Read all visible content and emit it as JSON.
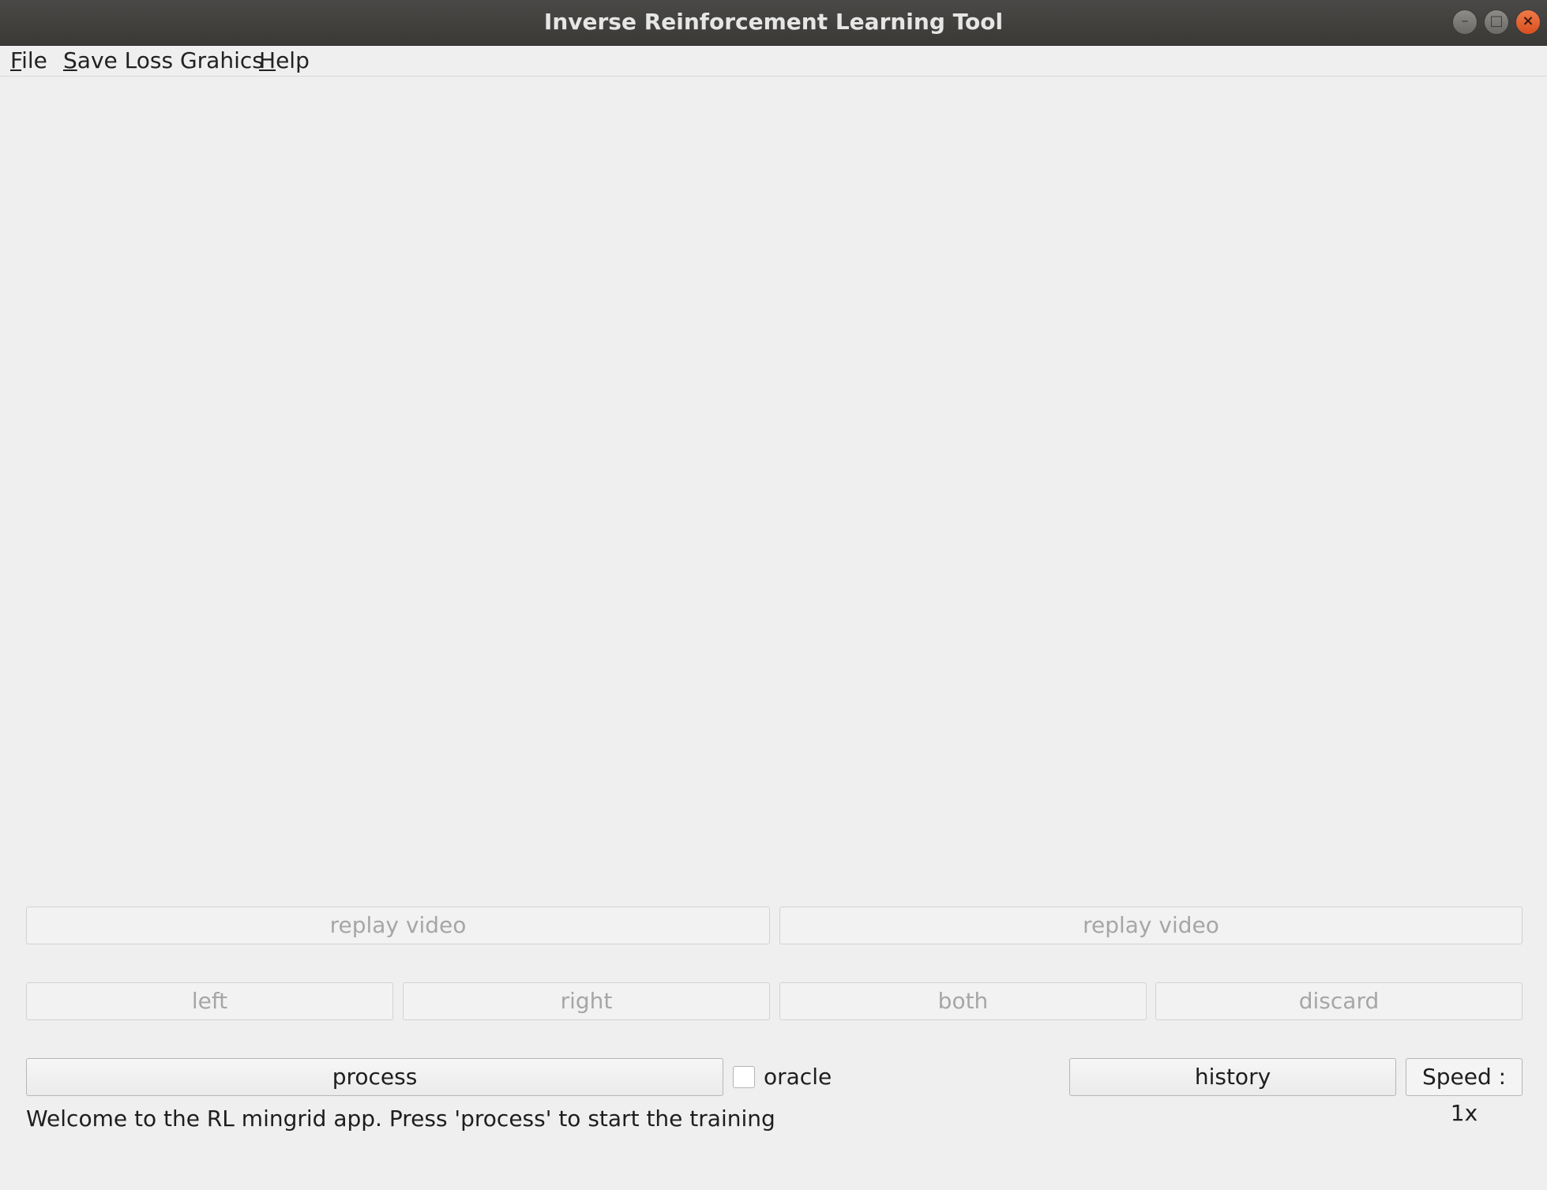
{
  "window": {
    "title": "Inverse Reinforcement Learning Tool",
    "minimize_glyph": "–",
    "maximize_glyph": "□",
    "close_glyph": "×"
  },
  "menu": {
    "items": [
      {
        "mnemonic": "F",
        "rest": "ile"
      },
      {
        "mnemonic": "S",
        "rest": "ave Loss Grahics"
      },
      {
        "mnemonic": "H",
        "rest": "elp"
      }
    ]
  },
  "controls": {
    "replay_left": "replay video",
    "replay_right": "replay video",
    "left": "left",
    "right": "right",
    "both": "both",
    "discard": "discard",
    "process": "process",
    "oracle_label": "oracle",
    "oracle_checked": false,
    "history": "history",
    "speed": "Speed : 1x"
  },
  "status": {
    "message": "Welcome to the RL mingrid app. Press 'process' to start the training"
  },
  "colors": {
    "titlebar": "#3f3e3b",
    "background": "#efefef",
    "close_button": "#e2612f",
    "disabled_text": "#a6a6a6"
  }
}
